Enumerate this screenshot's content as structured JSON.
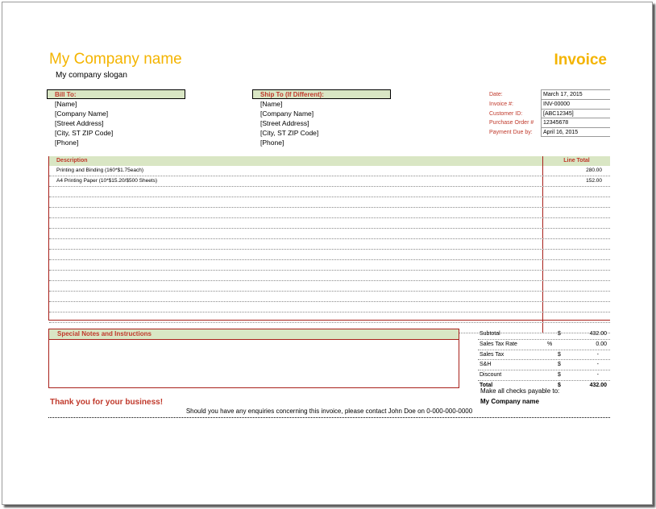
{
  "header": {
    "company_name": "My Company name",
    "company_slogan": "My company slogan",
    "title": "Invoice"
  },
  "bill_to": {
    "label": "Bill To:",
    "lines": [
      "[Name]",
      "[Company Name]",
      "[Street Address]",
      "[City, ST  ZIP Code]",
      "[Phone]"
    ]
  },
  "ship_to": {
    "label": "Ship To (If Different):",
    "lines": [
      "[Name]",
      "[Company Name]",
      "[Street Address]",
      "[City, ST  ZIP Code]",
      "[Phone]"
    ]
  },
  "meta": {
    "labels": [
      "Date:",
      "Invoice #:",
      "Customer ID:",
      "Purchase Order #",
      "Payment Due by:"
    ],
    "values": [
      "March 17, 2015",
      "INV-00000",
      "[ABC12345]",
      "12345678",
      "April 16, 2015"
    ]
  },
  "items": {
    "col_description": "Description",
    "col_total": "Line Total",
    "rows": [
      {
        "description": "Printing and Binding (160*$1.75each)",
        "total": "280.00"
      },
      {
        "description": "A4 Printing Paper (10*$15.20/$500 Sheets)",
        "total": "152.00"
      },
      {
        "description": "",
        "total": ""
      },
      {
        "description": "",
        "total": ""
      },
      {
        "description": "",
        "total": ""
      },
      {
        "description": "",
        "total": ""
      },
      {
        "description": "",
        "total": ""
      },
      {
        "description": "",
        "total": ""
      },
      {
        "description": "",
        "total": ""
      },
      {
        "description": "",
        "total": ""
      },
      {
        "description": "",
        "total": ""
      },
      {
        "description": "",
        "total": ""
      },
      {
        "description": "",
        "total": ""
      },
      {
        "description": "",
        "total": ""
      },
      {
        "description": "",
        "total": ""
      },
      {
        "description": "",
        "total": ""
      }
    ]
  },
  "notes": {
    "label": "Special Notes and Instructions"
  },
  "totals": {
    "subtotal_label": "Subtotal",
    "subtotal_sym": "$",
    "subtotal_val": "432.00",
    "tax_rate_label": "Sales Tax Rate",
    "tax_rate_sym": "%",
    "tax_rate_val": "0.00",
    "sales_tax_label": "Sales Tax",
    "sales_tax_sym": "$",
    "sales_tax_val": "-",
    "sh_label": "S&H",
    "sh_sym": "$",
    "sh_val": "-",
    "discount_label": "Discount",
    "discount_sym": "$",
    "discount_val": "-",
    "total_label": "Total",
    "total_sym": "$",
    "total_val": "432.00"
  },
  "payable": {
    "text": "Make all checks payable to:",
    "company": "My Company name"
  },
  "footer": {
    "thanks": "Thank you for your business!",
    "contact": "Should you have any enquiries concerning this invoice, please contact John Doe on 0-000-000-0000"
  }
}
